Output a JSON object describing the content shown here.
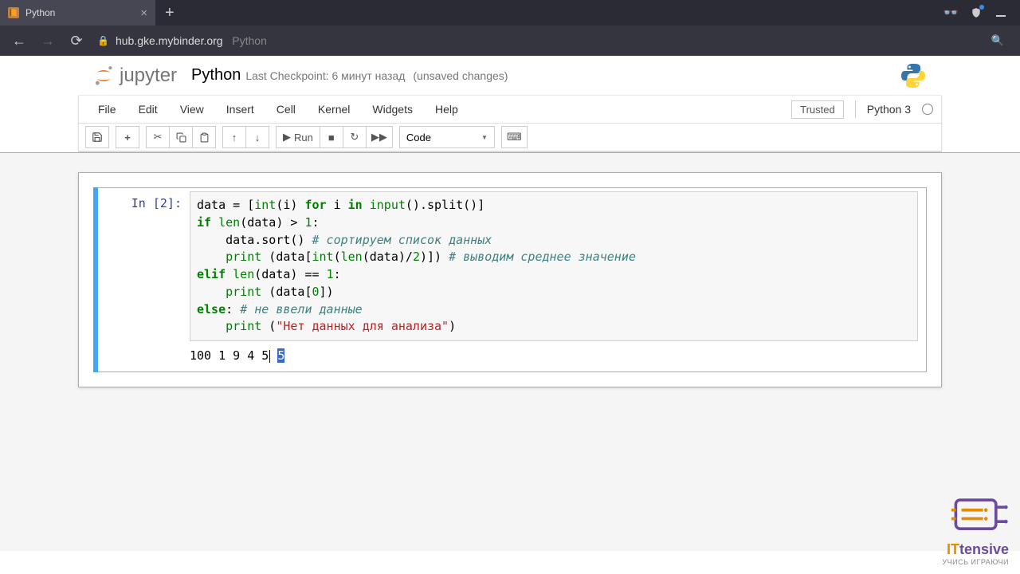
{
  "browser": {
    "tab_title": "Python",
    "url_host": "hub.gke.mybinder.org",
    "url_path": "Python"
  },
  "header": {
    "logo_text": "jupyter",
    "notebook_name": "Python",
    "checkpoint": "Last Checkpoint: 6 минут назад",
    "unsaved": "(unsaved changes)"
  },
  "menu": {
    "items": [
      "File",
      "Edit",
      "View",
      "Insert",
      "Cell",
      "Kernel",
      "Widgets",
      "Help"
    ],
    "trusted": "Trusted",
    "kernel": "Python 3"
  },
  "toolbar": {
    "run_label": "Run",
    "cell_type": "Code"
  },
  "cell": {
    "prompt": "In [2]:",
    "output_input": "100 1 9 4 5",
    "output_result": "5",
    "code": {
      "l1_a": "data ",
      "l1_op": "=",
      "l1_b": " [",
      "l1_int": "int",
      "l1_c": "(i) ",
      "l1_for": "for",
      "l1_d": " i ",
      "l1_in": "in",
      "l1_e": " ",
      "l1_input": "input",
      "l1_f": "().split()]",
      "l2_if": "if",
      "l2_a": " ",
      "l2_len": "len",
      "l2_b": "(data) > ",
      "l2_n": "1",
      "l2_c": ":",
      "l3_a": "    data.sort() ",
      "l3_cm": "# сортируем список данных",
      "l4_a": "    ",
      "l4_print": "print",
      "l4_b": " (data[",
      "l4_int": "int",
      "l4_c": "(",
      "l4_len": "len",
      "l4_d": "(data)/",
      "l4_n": "2",
      "l4_e": ")]) ",
      "l4_cm": "# выводим среднее значение",
      "l5_elif": "elif",
      "l5_a": " ",
      "l5_len": "len",
      "l5_b": "(data) == ",
      "l5_n": "1",
      "l5_c": ":",
      "l6_a": "    ",
      "l6_print": "print",
      "l6_b": " (data[",
      "l6_n": "0",
      "l6_c": "])",
      "l7_else": "else",
      "l7_a": ": ",
      "l7_cm": "# не ввели данные",
      "l8_a": "    ",
      "l8_print": "print",
      "l8_b": " (",
      "l8_s": "\"Нет данных для анализа\"",
      "l8_c": ")"
    }
  },
  "watermark": {
    "brand": "tensive",
    "prefix": "IT",
    "tagline": "УЧИСЬ ИГРАЮЧИ"
  }
}
